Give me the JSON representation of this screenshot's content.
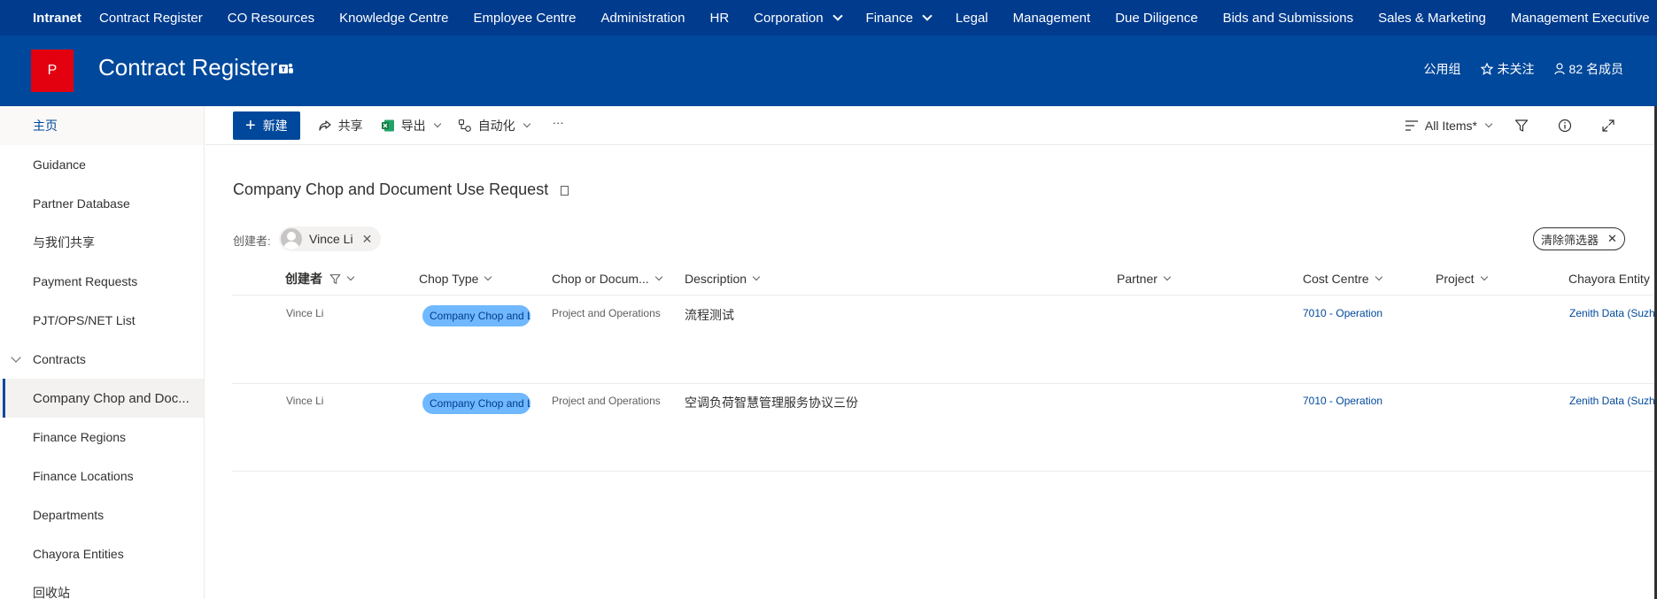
{
  "topnav": {
    "brand": "Intranet",
    "items": [
      {
        "label": "Contract Register"
      },
      {
        "label": "CO Resources"
      },
      {
        "label": "Knowledge Centre"
      },
      {
        "label": "Employee Centre"
      },
      {
        "label": "Administration"
      },
      {
        "label": "HR"
      },
      {
        "label": "Corporation"
      },
      {
        "label": "Finance"
      },
      {
        "label": "Legal"
      },
      {
        "label": "Management"
      },
      {
        "label": "Due Diligence"
      },
      {
        "label": "Bids and Submissions"
      },
      {
        "label": "Sales & Marketing"
      },
      {
        "label": "Management Executive"
      }
    ],
    "more": "···"
  },
  "site": {
    "logo_letter": "P",
    "title": "Contract Register",
    "group_type": "公用组",
    "follow_label": "未关注",
    "members_label": "82 名成员"
  },
  "leftnav": {
    "items": [
      {
        "label": "主页"
      },
      {
        "label": "Guidance"
      },
      {
        "label": "Partner Database"
      },
      {
        "label": "与我们共享"
      },
      {
        "label": "Payment Requests"
      },
      {
        "label": "PJT/OPS/NET List"
      },
      {
        "label": "Contracts"
      },
      {
        "label": "Company Chop and Doc..."
      },
      {
        "label": "Finance Regions"
      },
      {
        "label": "Finance Locations"
      },
      {
        "label": "Departments"
      },
      {
        "label": "Chayora Entities"
      },
      {
        "label": "回收站"
      }
    ]
  },
  "cmdbar": {
    "new_label": "新建",
    "share_label": "共享",
    "export_label": "导出",
    "automate_label": "自动化",
    "more": "···",
    "view_label": "All Items*"
  },
  "list": {
    "title": "Company Chop and Document Use Request",
    "filter_label": "创建者:",
    "filter_value": "Vince Li",
    "clear_filters": "清除筛选器",
    "columns": [
      {
        "label": "创建者"
      },
      {
        "label": "Chop Type"
      },
      {
        "label": "Chop or Docum..."
      },
      {
        "label": "Description"
      },
      {
        "label": "Partner"
      },
      {
        "label": "Cost Centre"
      },
      {
        "label": "Project"
      },
      {
        "label": "Chayora Entity"
      }
    ],
    "rows": [
      {
        "created_by": "Vince Li",
        "chop_type": "Company Chop and L",
        "chop_or_doc": "Project and Operations",
        "description": "流程测试",
        "partner": "",
        "cost_centre": "7010 - Operation",
        "project": "",
        "entity": "Zenith Data (Suzho"
      },
      {
        "created_by": "Vince Li",
        "chop_type": "Company Chop and L",
        "chop_or_doc": "Project and Operations",
        "description": "空调负荷智慧管理服务协议三份",
        "partner": "",
        "cost_centre": "7010 - Operation",
        "project": "",
        "entity": "Zenith Data (Suzho"
      }
    ]
  }
}
